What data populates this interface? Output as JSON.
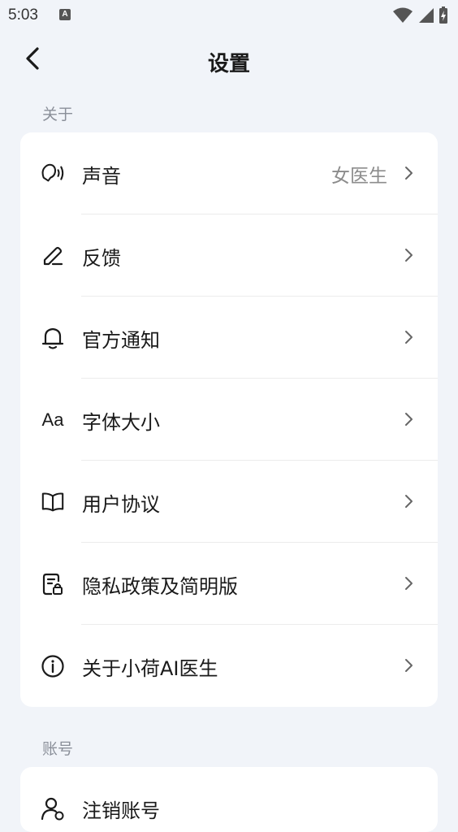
{
  "status_bar": {
    "time": "5:03",
    "notif_icon_letter": "A"
  },
  "header": {
    "title": "设置"
  },
  "sections": [
    {
      "label": "关于",
      "items": [
        {
          "icon": "voice-icon",
          "label": "声音",
          "value": "女医生"
        },
        {
          "icon": "edit-pen-icon",
          "label": "反馈",
          "value": ""
        },
        {
          "icon": "bell-icon",
          "label": "官方通知",
          "value": ""
        },
        {
          "icon": "font-size-icon",
          "icon_text": "Aa",
          "label": "字体大小",
          "value": ""
        },
        {
          "icon": "book-icon",
          "label": "用户协议",
          "value": ""
        },
        {
          "icon": "privacy-document-lock-icon",
          "label": "隐私政策及简明版",
          "value": ""
        },
        {
          "icon": "info-icon",
          "label": "关于小荷AI医生",
          "value": ""
        }
      ]
    },
    {
      "label": "账号",
      "items": [
        {
          "icon": "user-account-icon",
          "label": "注销账号",
          "value": ""
        }
      ]
    }
  ]
}
